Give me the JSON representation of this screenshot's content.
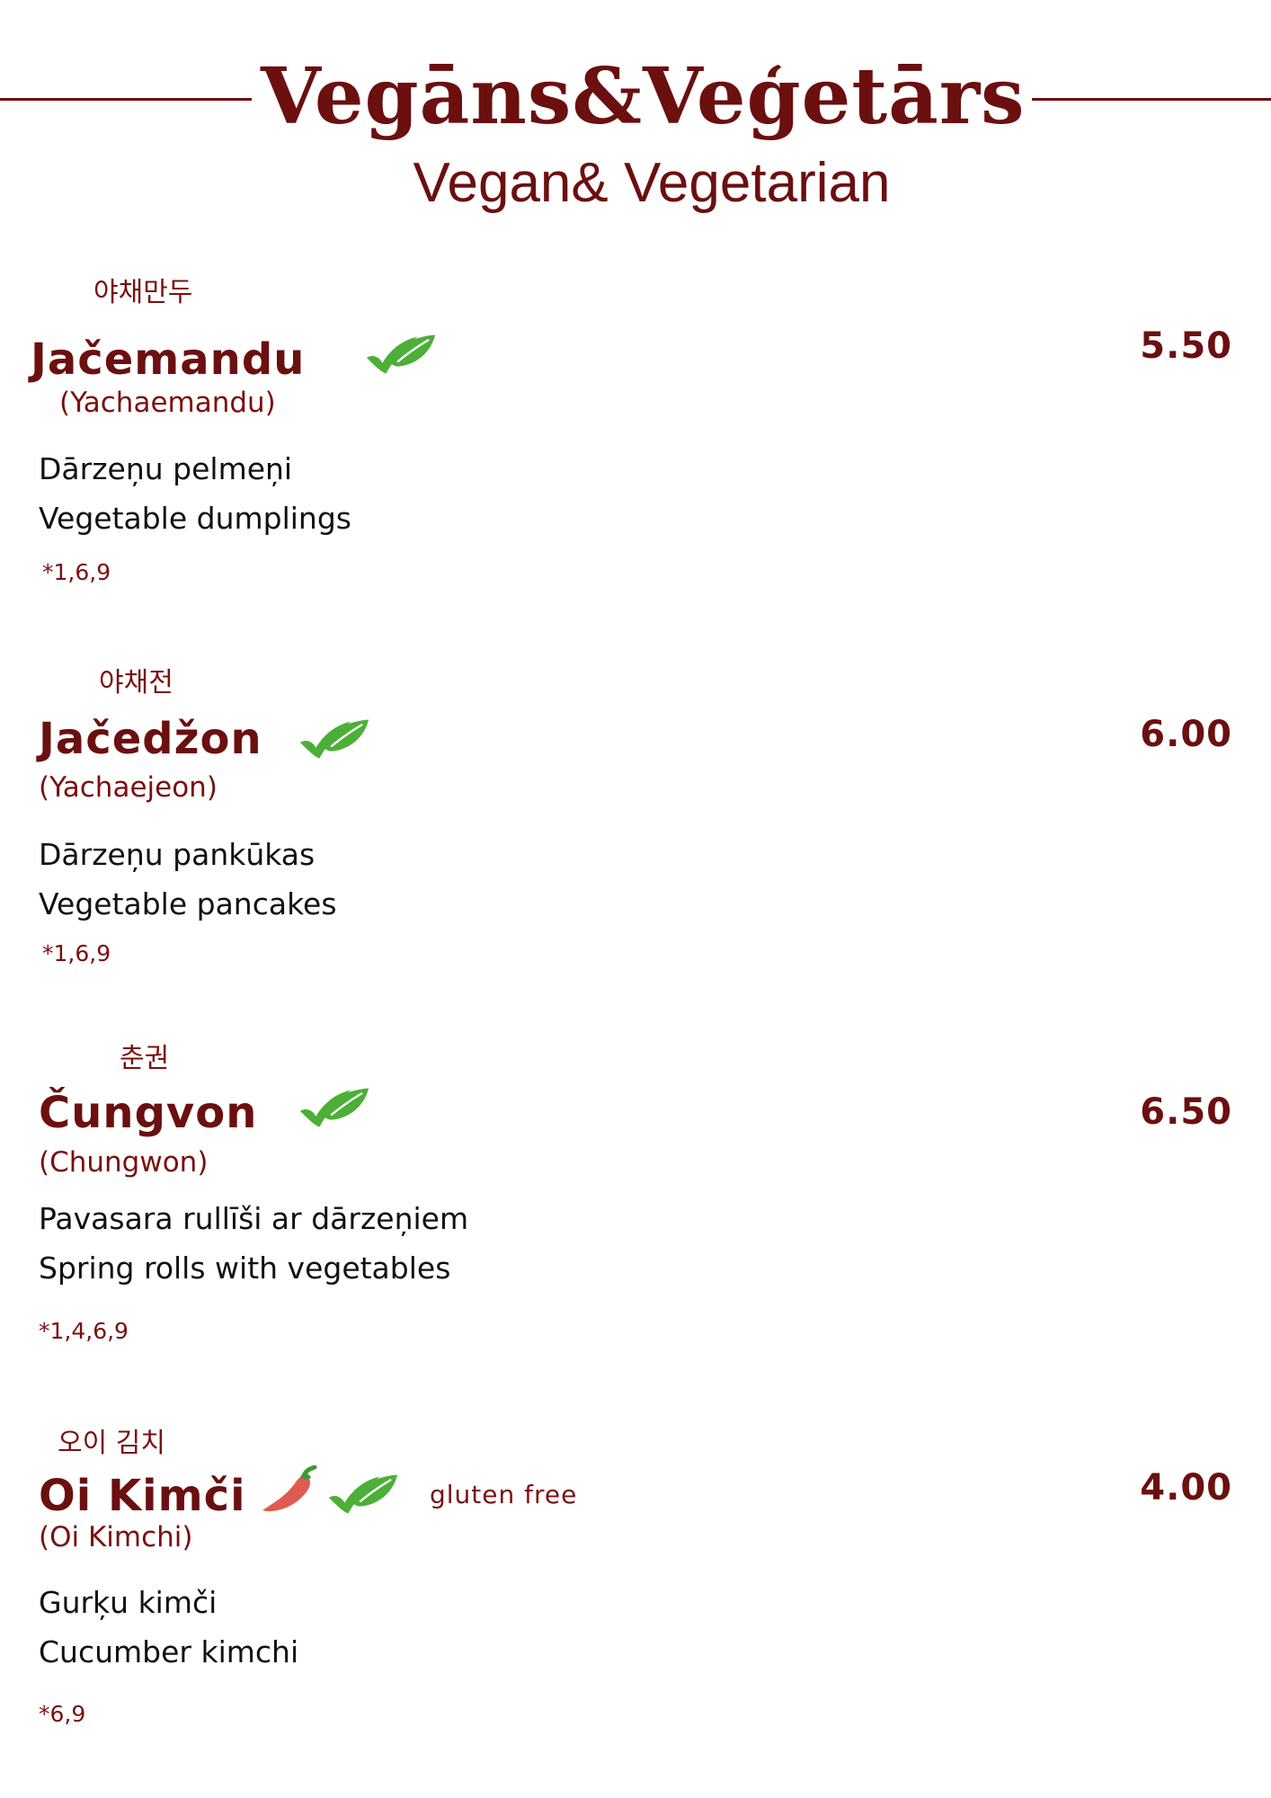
{
  "header": {
    "title_lv": "Vegāns&Veģetārs",
    "title_en": "Vegan& Vegetarian"
  },
  "icons": {
    "vegan": "vegan-leaf-check-icon",
    "spicy": "chili-pepper-icon"
  },
  "colors": {
    "accent": "#6b0f0f",
    "leaf": "#4caf38",
    "chili": "#e05a4f"
  },
  "items": [
    {
      "korean": "야채만두",
      "name": "Jačemandu",
      "romanized": "(Yachaemandu)",
      "desc_lv": "Dārzeņu pelmeņi",
      "desc_en": "Vegetable dumplings",
      "allergens": "*1,6,9",
      "price": "5.50"
    },
    {
      "korean": "야채전",
      "name": "Jačedžon",
      "romanized": "(Yachaejeon)",
      "desc_lv": "Dārzeņu pankūkas",
      "desc_en": "Vegetable pancakes",
      "allergens": "*1,6,9",
      "price": "6.00"
    },
    {
      "korean": "춘권",
      "name": "Čungvon",
      "romanized": "(Chungwon)",
      "desc_lv": "Pavasara rullīši ar dārzeņiem",
      "desc_en": "Spring rolls with vegetables",
      "allergens": "*1,4,6,9",
      "price": "6.50"
    },
    {
      "korean": "오이 김치",
      "name": "Oi Kimči",
      "romanized": "(Oi Kimchi)",
      "badge": "gluten free",
      "desc_lv": "Gurķu kimči",
      "desc_en": "Cucumber kimchi",
      "allergens": "*6,9",
      "price": "4.00"
    }
  ]
}
